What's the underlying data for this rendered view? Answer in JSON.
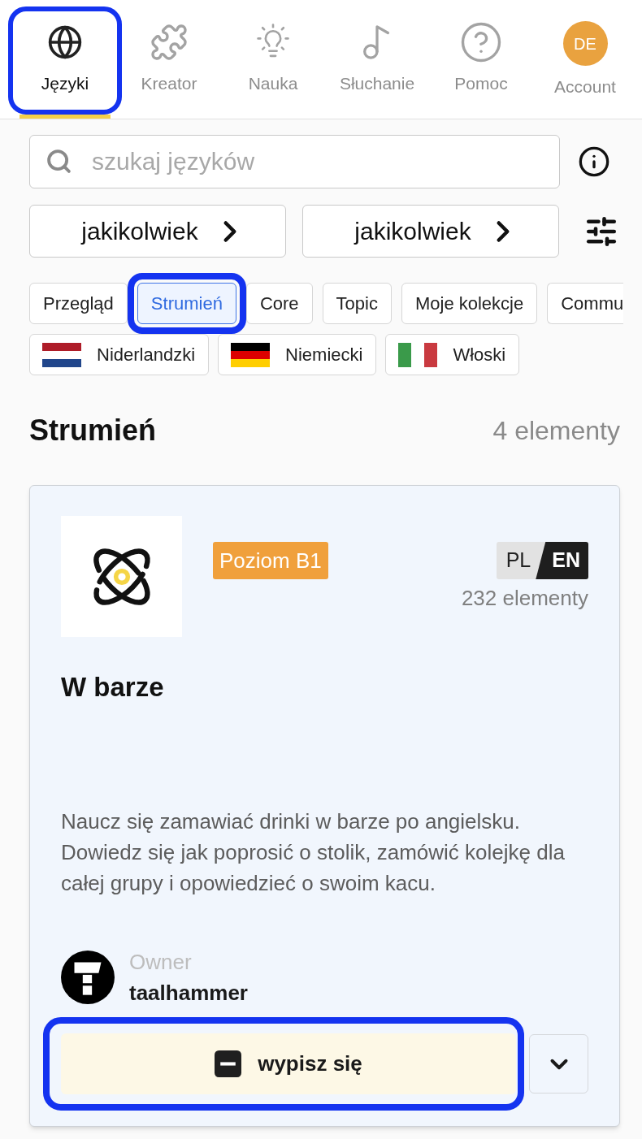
{
  "nav": {
    "items": [
      {
        "label": "Języki",
        "selected": true
      },
      {
        "label": "Kreator",
        "selected": false
      },
      {
        "label": "Nauka",
        "selected": false
      },
      {
        "label": "Słuchanie",
        "selected": false
      },
      {
        "label": "Pomoc",
        "selected": false
      },
      {
        "label": "Account",
        "selected": false,
        "avatar_initials": "DE"
      }
    ]
  },
  "search": {
    "placeholder": "szukaj języków"
  },
  "filters": [
    {
      "label": "jakikolwiek"
    },
    {
      "label": "jakikolwiek"
    }
  ],
  "tabs": [
    {
      "label": "Przegląd",
      "selected": false
    },
    {
      "label": "Strumień",
      "selected": true
    },
    {
      "label": "Core",
      "selected": false
    },
    {
      "label": "Topic",
      "selected": false
    },
    {
      "label": "Moje kolekcje",
      "selected": false
    },
    {
      "label": "Commu",
      "selected": false
    }
  ],
  "languages": [
    {
      "label": "Niderlandzki",
      "kind": "dutch"
    },
    {
      "label": "Niemiecki",
      "kind": "german"
    },
    {
      "label": "Włoski",
      "kind": "italian"
    }
  ],
  "section": {
    "title": "Strumień",
    "count": "4 elementy"
  },
  "card": {
    "level_badge": "Poziom B1",
    "source_language": "PL",
    "target_language": "EN",
    "item_count": "232 elementy",
    "title": "W barze",
    "description": "Naucz się zamawiać drinki w barze po angielsku. Dowiedz się jak poprosić o stolik, zamówić kolejkę dla całej grupy i opowiedzieć o swoim kacu.",
    "owner_label": "Owner",
    "owner_name": "taalhammer",
    "action": {
      "label": "wypisz się",
      "highlighted": true
    }
  }
}
